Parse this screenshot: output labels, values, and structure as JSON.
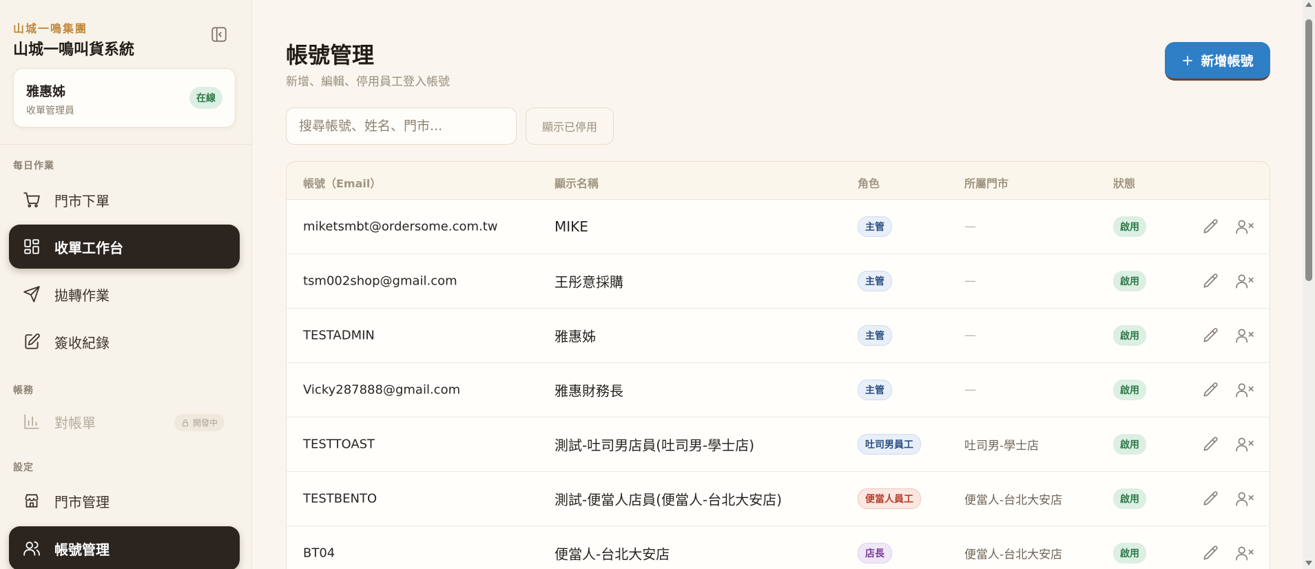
{
  "sidebar": {
    "brand_sub": "山城一鳴集團",
    "brand_title": "山城一鳴叫貨系統",
    "user": {
      "name": "雅惠姊",
      "role": "收單管理員",
      "status": "在線"
    },
    "sections": {
      "daily": "每日作業",
      "accounts": "帳務",
      "settings": "設定"
    },
    "items": [
      {
        "label": "門市下單",
        "icon": "cart-icon"
      },
      {
        "label": "收單工作台",
        "icon": "dashboard-icon"
      },
      {
        "label": "拋轉作業",
        "icon": "send-icon"
      },
      {
        "label": "簽收紀錄",
        "icon": "edit-note-icon"
      },
      {
        "label": "對帳單",
        "icon": "bar-chart-icon",
        "badge": "開發中"
      },
      {
        "label": "門市管理",
        "icon": "store-icon"
      },
      {
        "label": "帳號管理",
        "icon": "users-icon"
      }
    ]
  },
  "main": {
    "title": "帳號管理",
    "subtitle": "新增、編輯、停用員工登入帳號",
    "add_button": "新增帳號",
    "search_placeholder": "搜尋帳號、姓名、門市...",
    "show_disabled": "顯示已停用",
    "columns": {
      "email": "帳號（Email）",
      "name": "顯示名稱",
      "role": "角色",
      "store": "所屬門市",
      "status": "狀態"
    },
    "rows": [
      {
        "email": "miketsmbt@ordersome.com.tw",
        "name": "MIKE",
        "role": "主管",
        "store": "—",
        "status": "啟用"
      },
      {
        "email": "tsm002shop@gmail.com",
        "name": "王彤意採購",
        "role": "主管",
        "store": "—",
        "status": "啟用"
      },
      {
        "email": "TESTADMIN",
        "name": "雅惠姊",
        "role": "主管",
        "store": "—",
        "status": "啟用"
      },
      {
        "email": "Vicky287888@gmail.com",
        "name": "雅惠財務長",
        "role": "主管",
        "store": "—",
        "status": "啟用"
      },
      {
        "email": "TESTTOAST",
        "name": "測試-吐司男店員(吐司男-學士店)",
        "role": "吐司男員工",
        "store": "吐司男-學士店",
        "status": "啟用"
      },
      {
        "email": "TESTBENTO",
        "name": "測試-便當人店員(便當人-台北大安店)",
        "role": "便當人員工",
        "store": "便當人-台北大安店",
        "status": "啟用"
      },
      {
        "email": "BT04",
        "name": "便當人-台北大安店",
        "role": "店長",
        "store": "便當人-台北大安店",
        "status": "啟用"
      }
    ]
  },
  "colors": {
    "accent_button": "#2f7fc7",
    "active_nav": "#2b241f",
    "brand_gold": "#c08a3e",
    "status_green": "#2f7a4a"
  }
}
